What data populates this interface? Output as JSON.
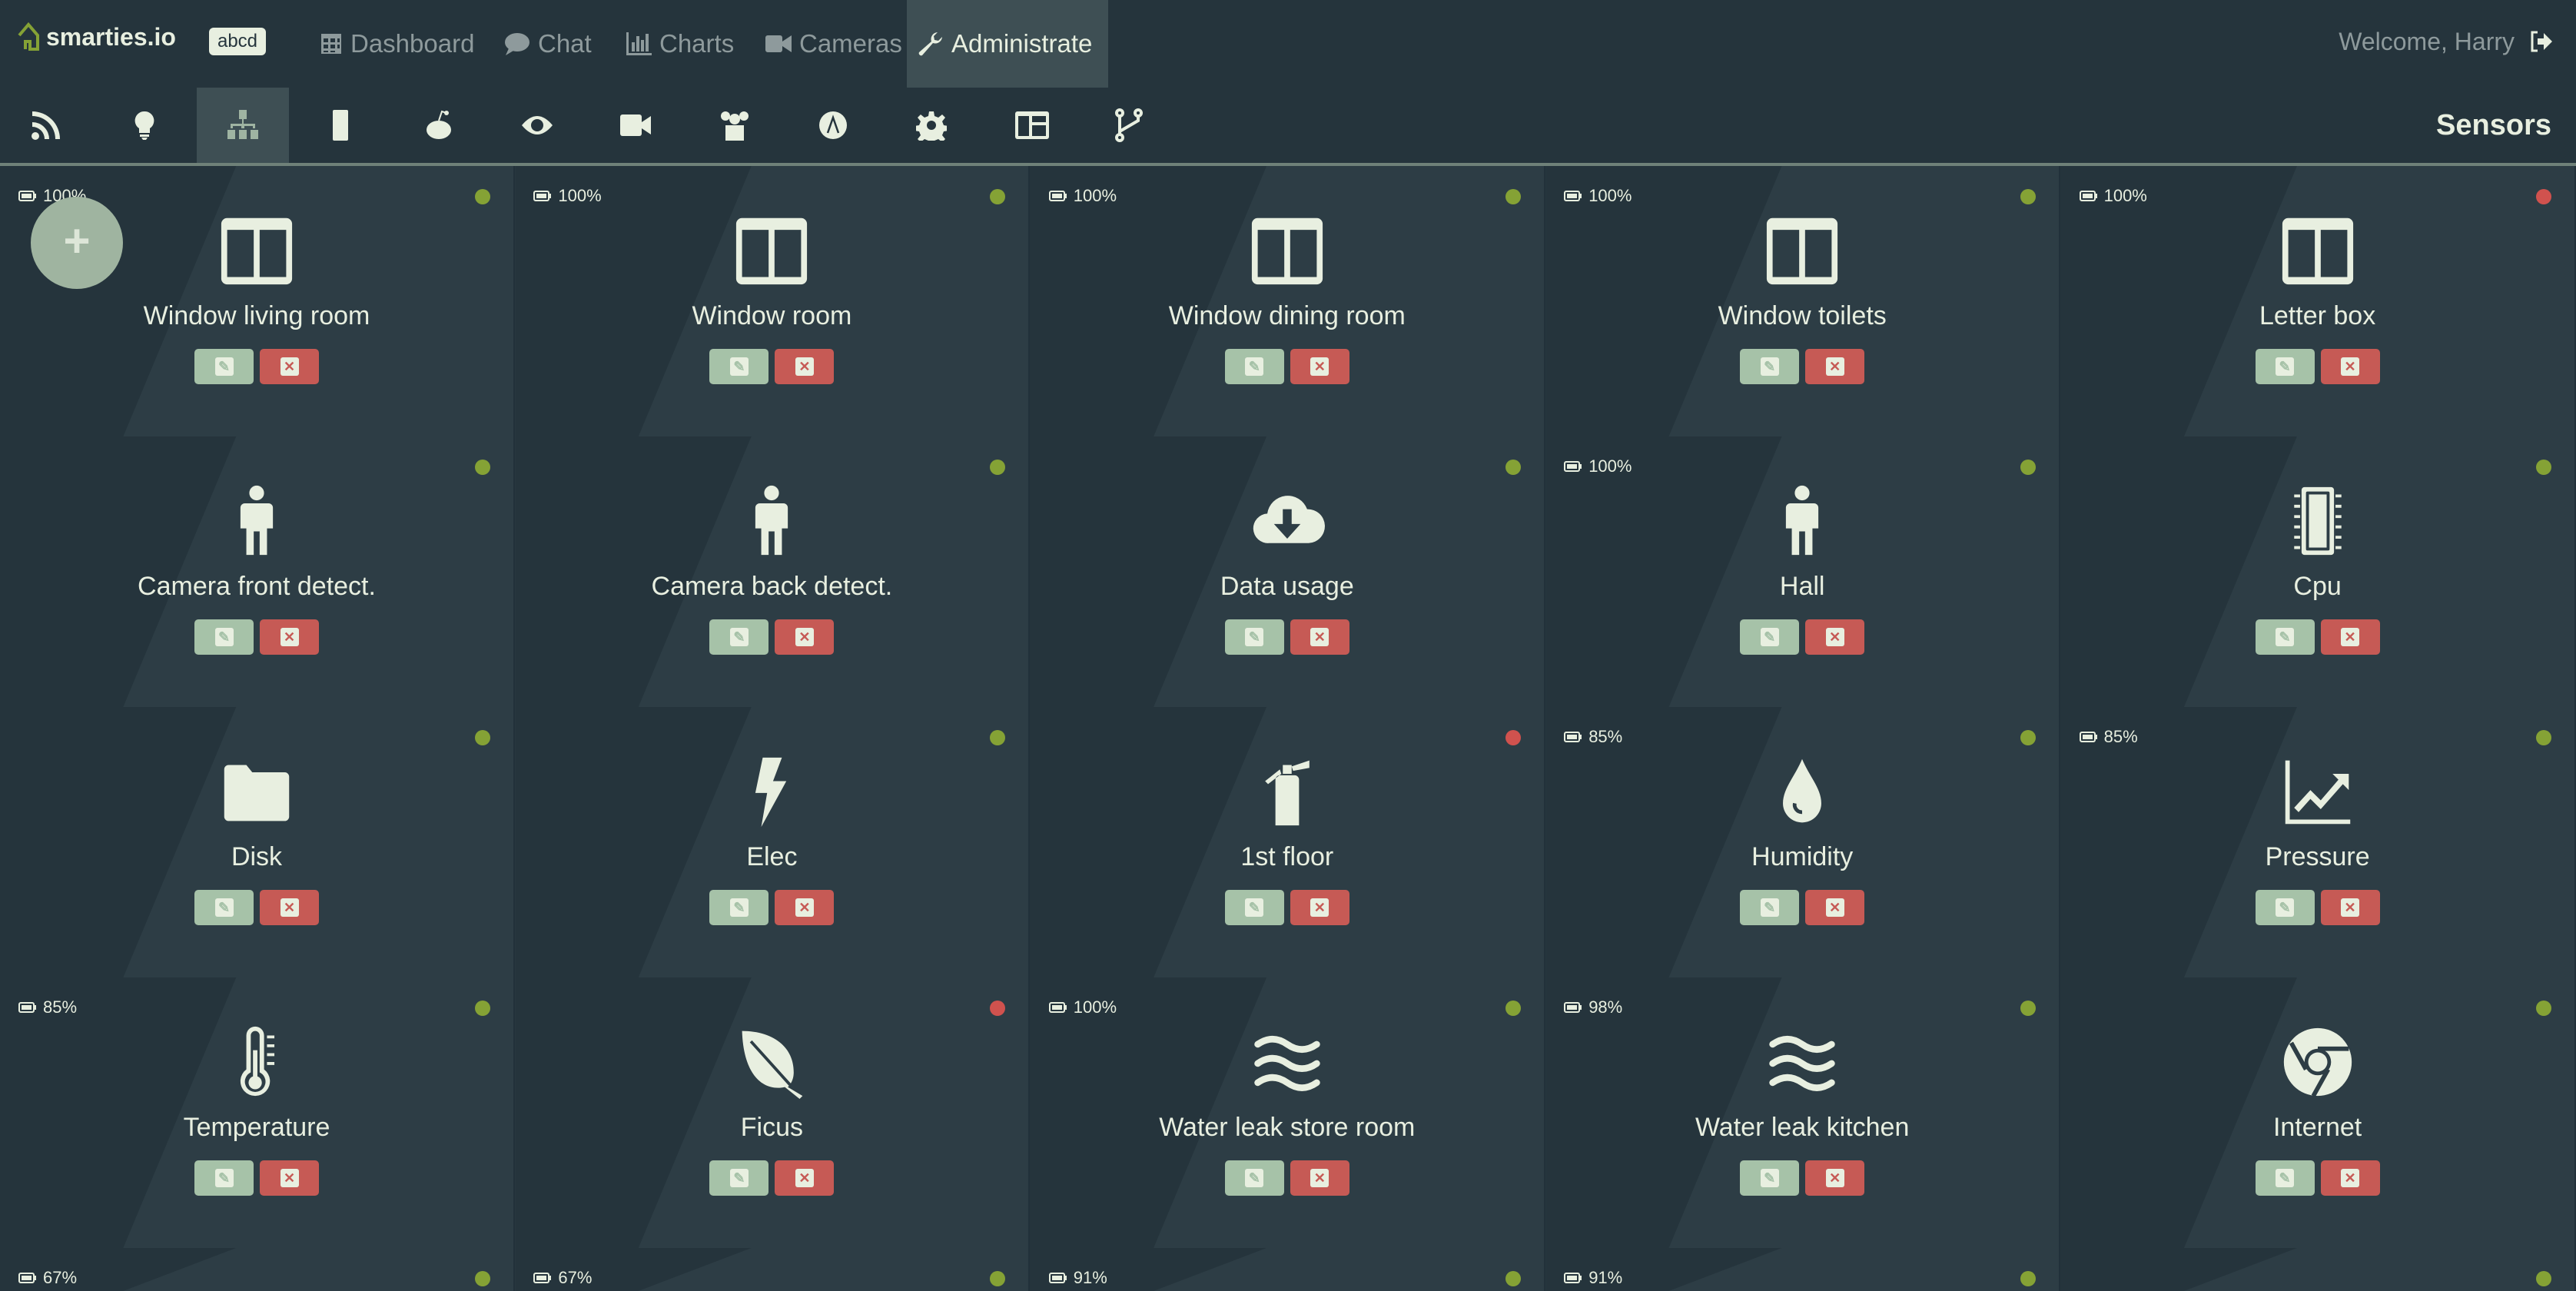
{
  "app": {
    "name": "smarties.io",
    "badge": "abcd",
    "welcome": "Welcome, Harry"
  },
  "nav": [
    {
      "label": "Dashboard",
      "icon": "table-icon",
      "active": false
    },
    {
      "label": "Chat",
      "icon": "chat-icon",
      "active": false
    },
    {
      "label": "Charts",
      "icon": "bar-chart-icon",
      "active": false
    },
    {
      "label": "Cameras",
      "icon": "video-icon",
      "active": false
    },
    {
      "label": "Administrate",
      "icon": "wrench-icon",
      "active": true
    }
  ],
  "toolbar": [
    "rss-icon",
    "lightbulb-icon",
    "sitemap-icon",
    "chip-icon",
    "reddit-icon",
    "eye-icon",
    "video-icon",
    "users-icon",
    "alexa-icon",
    "gear-icon",
    "dashboard-icon",
    "fork-icon"
  ],
  "toolbar_selected": 2,
  "section_title": "Sensors",
  "add_label": "+",
  "colors": {
    "ok": "#85a235",
    "error": "#d0524e",
    "accent": "#85a235"
  },
  "sensors": [
    {
      "name": "Window living room",
      "icon": "window",
      "battery": "100%",
      "status": "ok"
    },
    {
      "name": "Window room",
      "icon": "window",
      "battery": "100%",
      "status": "ok"
    },
    {
      "name": "Window dining room",
      "icon": "window",
      "battery": "100%",
      "status": "ok"
    },
    {
      "name": "Window toilets",
      "icon": "window",
      "battery": "100%",
      "status": "ok"
    },
    {
      "name": "Letter box",
      "icon": "window",
      "battery": "100%",
      "status": "error"
    },
    {
      "name": "Camera front detect.",
      "icon": "person",
      "battery": null,
      "status": "ok"
    },
    {
      "name": "Camera back detect.",
      "icon": "person",
      "battery": null,
      "status": "ok"
    },
    {
      "name": "Data usage",
      "icon": "cloud-download",
      "battery": null,
      "status": "ok"
    },
    {
      "name": "Hall",
      "icon": "person",
      "battery": "100%",
      "status": "ok"
    },
    {
      "name": "Cpu",
      "icon": "chip",
      "battery": null,
      "status": "ok"
    },
    {
      "name": "Disk",
      "icon": "folder",
      "battery": null,
      "status": "ok"
    },
    {
      "name": "Elec",
      "icon": "bolt",
      "battery": null,
      "status": "ok"
    },
    {
      "name": "1st floor",
      "icon": "extinguisher",
      "battery": null,
      "status": "error"
    },
    {
      "name": "Humidity",
      "icon": "drop",
      "battery": "85%",
      "status": "ok"
    },
    {
      "name": "Pressure",
      "icon": "line-chart",
      "battery": "85%",
      "status": "ok"
    },
    {
      "name": "Temperature",
      "icon": "thermometer",
      "battery": "85%",
      "status": "ok"
    },
    {
      "name": "Ficus",
      "icon": "leaf",
      "battery": null,
      "status": "error"
    },
    {
      "name": "Water leak store room",
      "icon": "water",
      "battery": "100%",
      "status": "ok"
    },
    {
      "name": "Water leak kitchen",
      "icon": "water",
      "battery": "98%",
      "status": "ok"
    },
    {
      "name": "Internet",
      "icon": "chrome",
      "battery": null,
      "status": "ok"
    },
    {
      "name": "",
      "icon": null,
      "battery": "67%",
      "status": "ok"
    },
    {
      "name": "",
      "icon": null,
      "battery": "67%",
      "status": "ok"
    },
    {
      "name": "",
      "icon": null,
      "battery": "91%",
      "status": "ok"
    },
    {
      "name": "",
      "icon": null,
      "battery": "91%",
      "status": "ok"
    },
    {
      "name": "",
      "icon": null,
      "battery": null,
      "status": "ok"
    }
  ]
}
